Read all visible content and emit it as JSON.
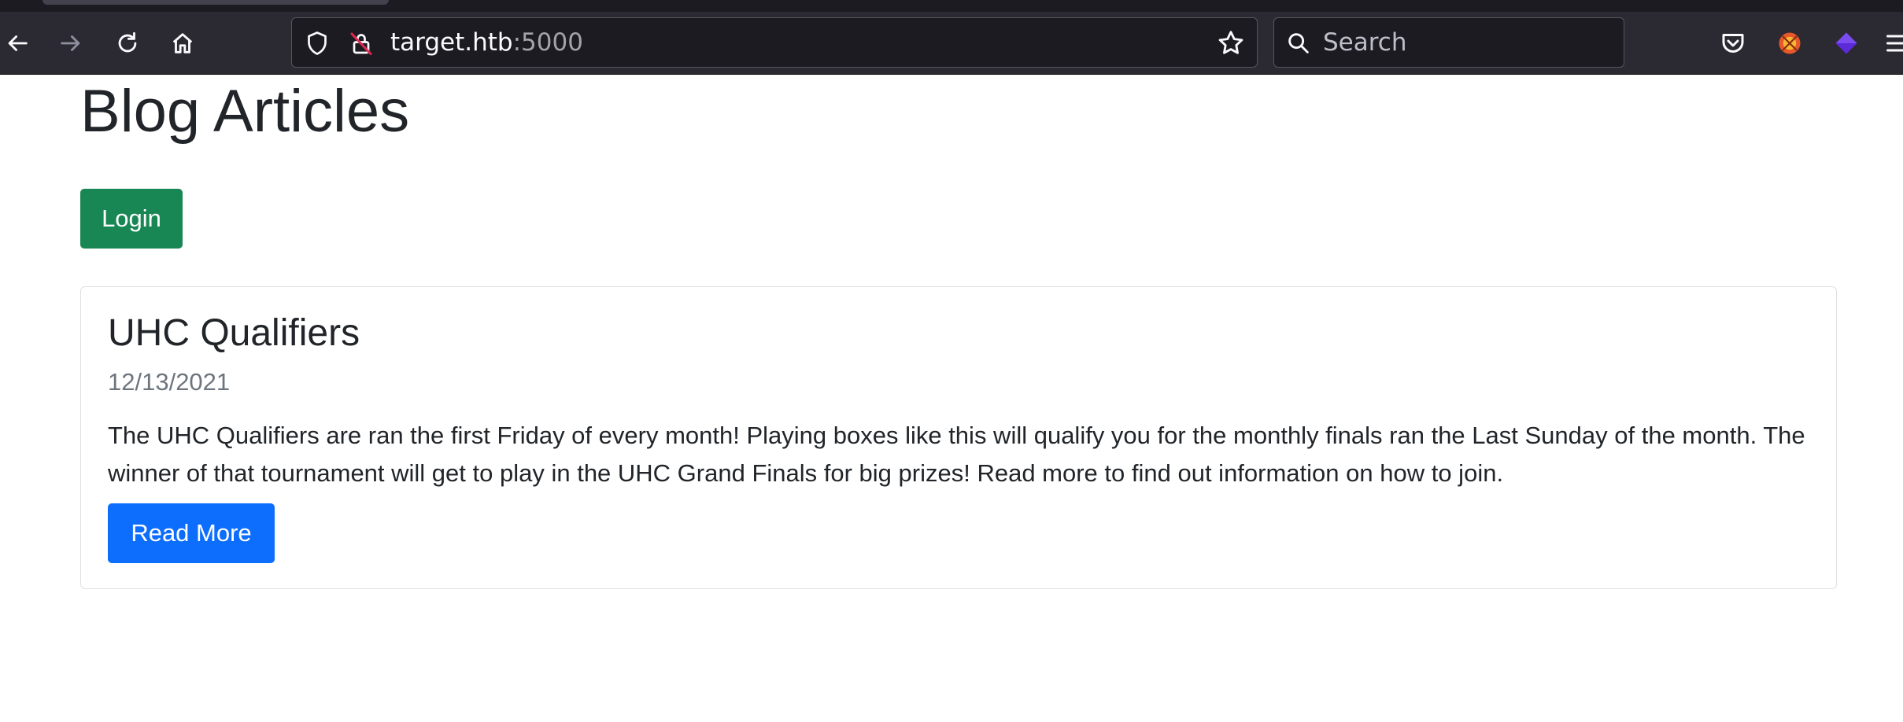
{
  "browser": {
    "url_host": "target.htb",
    "url_port": ":5000",
    "search_placeholder": "Search",
    "icons": [
      "back-icon",
      "forward-icon",
      "reload-icon",
      "home-icon",
      "shield-icon",
      "lock-icon",
      "star-icon",
      "search-icon",
      "pocket-icon",
      "extension-icon",
      "extension-icon",
      "menu-icon"
    ]
  },
  "page": {
    "title": "Blog Articles",
    "login_label": "Login"
  },
  "articles": [
    {
      "title": "UHC Qualifiers",
      "date": "12/13/2021",
      "body": "The UHC Qualifiers are ran the first Friday of every month! Playing boxes like this will qualify you for the monthly finals ran the Last Sunday of the month. The winner of that tournament will get to play in the UHC Grand Finals for big prizes! Read more to find out information on how to join.",
      "read_more_label": "Read More"
    }
  ],
  "colors": {
    "login_button": "#198754",
    "read_more_button": "#0d6efd",
    "browser_toolbar": "#2b2a33",
    "muted_text": "#6c757d"
  }
}
